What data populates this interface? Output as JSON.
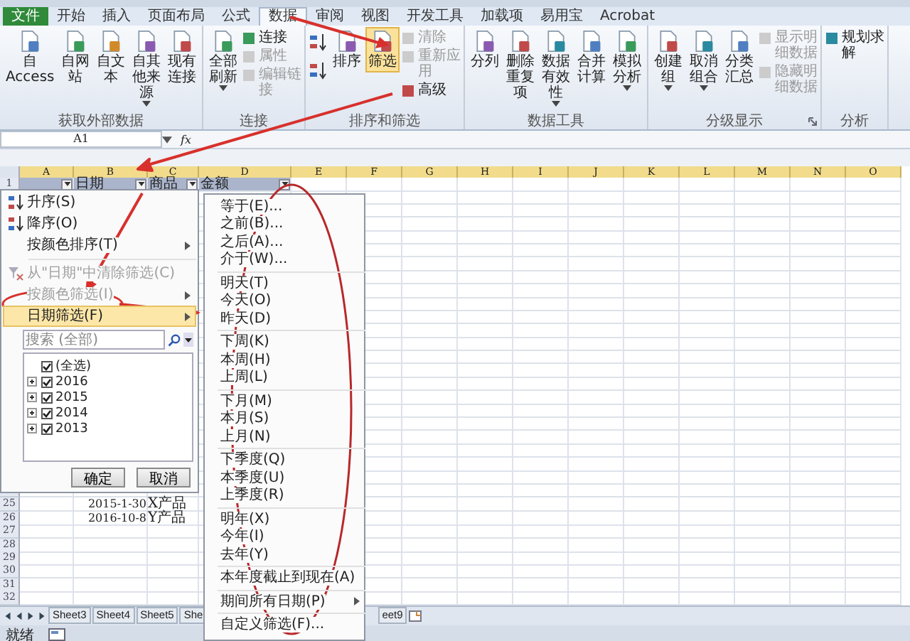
{
  "tabs": [
    {
      "label": "文件",
      "kind": "file",
      "selected": false
    },
    {
      "label": "开始",
      "kind": "tab",
      "selected": false
    },
    {
      "label": "插入",
      "kind": "tab",
      "selected": false
    },
    {
      "label": "页面布局",
      "kind": "tab",
      "selected": false
    },
    {
      "label": "公式",
      "kind": "tab",
      "selected": false
    },
    {
      "label": "数据",
      "kind": "tab",
      "selected": true
    },
    {
      "label": "审阅",
      "kind": "tab",
      "selected": false
    },
    {
      "label": "视图",
      "kind": "tab",
      "selected": false
    },
    {
      "label": "开发工具",
      "kind": "tab",
      "selected": false
    },
    {
      "label": "加载项",
      "kind": "tab",
      "selected": false
    },
    {
      "label": "易用宝",
      "kind": "tab",
      "selected": false
    },
    {
      "label": "Acrobat",
      "kind": "tab",
      "selected": false
    }
  ],
  "ribbon": {
    "groups": [
      {
        "label": "获取外部数据",
        "items": [
          {
            "kind": "large",
            "label": "自Access",
            "on": false,
            "dropdown": false
          },
          {
            "kind": "large",
            "label": "自网站",
            "on": false,
            "dropdown": false
          },
          {
            "kind": "large",
            "label": "自文本",
            "on": false,
            "dropdown": false
          },
          {
            "kind": "large",
            "label": "自其他来源",
            "on": false,
            "dropdown": true
          },
          {
            "kind": "large",
            "label": "现有连接",
            "on": false,
            "dropdown": false
          }
        ]
      },
      {
        "label": "连接",
        "items": [
          {
            "kind": "large",
            "label": "全部刷新",
            "on": false,
            "dropdown": true
          },
          {
            "kind": "stack",
            "items": [
              {
                "label": "连接",
                "disabled": false
              },
              {
                "label": "属性",
                "disabled": true
              },
              {
                "label": "编辑链接",
                "disabled": true
              }
            ]
          }
        ]
      },
      {
        "label": "排序和筛选",
        "items": [
          {
            "kind": "sort"
          },
          {
            "kind": "large",
            "label": "排序",
            "on": false,
            "dropdown": false
          },
          {
            "kind": "large",
            "label": "筛选",
            "on": true,
            "dropdown": false
          },
          {
            "kind": "stack",
            "items": [
              {
                "label": "清除",
                "disabled": true
              },
              {
                "label": "重新应用",
                "disabled": true
              },
              {
                "label": "高级",
                "disabled": false
              }
            ]
          }
        ]
      },
      {
        "label": "数据工具",
        "items": [
          {
            "kind": "large",
            "label": "分列",
            "on": false,
            "dropdown": false
          },
          {
            "kind": "large",
            "label": "删除重复项",
            "on": false,
            "dropdown": false
          },
          {
            "kind": "large",
            "label": "数据有效性",
            "on": false,
            "dropdown": true
          },
          {
            "kind": "large",
            "label": "合并计算",
            "on": false,
            "dropdown": false
          },
          {
            "kind": "large",
            "label": "模拟分析",
            "on": false,
            "dropdown": true
          }
        ]
      },
      {
        "label": "分级显示",
        "launcher": true,
        "items": [
          {
            "kind": "large",
            "label": "创建组",
            "on": false,
            "dropdown": true
          },
          {
            "kind": "large",
            "label": "取消组合",
            "on": false,
            "dropdown": true
          },
          {
            "kind": "large",
            "label": "分类汇总",
            "on": false,
            "dropdown": false
          },
          {
            "kind": "stack",
            "items": [
              {
                "label": "显示明细数据",
                "disabled": true
              },
              {
                "label": "隐藏明细数据",
                "disabled": true
              }
            ]
          }
        ]
      },
      {
        "label": "分析",
        "items": [
          {
            "kind": "stack",
            "items": [
              {
                "label": "规划求解",
                "disabled": false
              }
            ]
          }
        ]
      }
    ]
  },
  "formula_bar": {
    "name_box": "A1",
    "function_label": "fx"
  },
  "grid": {
    "columns": [
      "A",
      "B",
      "C",
      "D",
      "E",
      "F",
      "G",
      "H",
      "I",
      "J",
      "K",
      "L",
      "M",
      "N",
      "O"
    ],
    "rows": [
      {
        "number": "1",
        "cells": [
          {
            "filter": true
          },
          {
            "text": "日期",
            "filter": true
          },
          {
            "text": "商品",
            "filter": true
          },
          {
            "text": "金额",
            "filter": true
          }
        ]
      },
      {
        "number": "25",
        "cells": [
          {
            "filter": false
          },
          {
            "text": "2015-1-30",
            "filter": false
          },
          {
            "text": "X产品",
            "filter": false
          }
        ]
      },
      {
        "number": "26",
        "cells": [
          {
            "filter": false
          },
          {
            "text": "2016-10-8",
            "filter": false
          },
          {
            "text": "Y产品",
            "filter": false
          }
        ]
      },
      {
        "number": "27"
      },
      {
        "number": "28"
      },
      {
        "number": "29"
      },
      {
        "number": "30"
      },
      {
        "number": "31"
      },
      {
        "number": "32"
      }
    ]
  },
  "filter_menu": {
    "items": [
      {
        "kind": "sort_asc",
        "label": "升序(S)",
        "disabled": false,
        "selected": false,
        "submenu": false
      },
      {
        "kind": "sort_desc",
        "label": "降序(O)",
        "disabled": false,
        "selected": false,
        "submenu": false
      },
      {
        "kind": "plain",
        "label": "按颜色排序(T)",
        "disabled": false,
        "selected": false,
        "submenu": true
      },
      {
        "kind": "clear",
        "label": "从\"日期\"中清除筛选(C)",
        "disabled": true,
        "selected": false,
        "submenu": false
      },
      {
        "kind": "plain",
        "label": "按颜色筛选(I)",
        "disabled": true,
        "selected": false,
        "submenu": true
      },
      {
        "kind": "plain",
        "label": "日期筛选(F)",
        "disabled": false,
        "selected": true,
        "submenu": true
      }
    ],
    "search": {
      "placeholder": "搜索 (全部)"
    },
    "tree": [
      {
        "label": "(全选)",
        "checked": true
      },
      {
        "label": "2016",
        "checked": true,
        "expanded": false
      },
      {
        "label": "2015",
        "checked": true,
        "expanded": false
      },
      {
        "label": "2014",
        "checked": true,
        "expanded": false
      },
      {
        "label": "2013",
        "checked": true,
        "expanded": false
      }
    ],
    "buttons": [
      "确定",
      "取消"
    ]
  },
  "date_filter_menu": {
    "groups": [
      [
        {
          "label": "等于(E)..."
        },
        {
          "label": "之前(B)..."
        },
        {
          "label": "之后(A)..."
        },
        {
          "label": "介于(W)..."
        }
      ],
      [
        {
          "label": "明天(T)"
        },
        {
          "label": "今天(O)"
        },
        {
          "label": "昨天(D)"
        }
      ],
      [
        {
          "label": "下周(K)"
        },
        {
          "label": "本周(H)"
        },
        {
          "label": "上周(L)"
        }
      ],
      [
        {
          "label": "下月(M)"
        },
        {
          "label": "本月(S)"
        },
        {
          "label": "上月(N)"
        }
      ],
      [
        {
          "label": "下季度(Q)"
        },
        {
          "label": "本季度(U)"
        },
        {
          "label": "上季度(R)"
        }
      ],
      [
        {
          "label": "明年(X)"
        },
        {
          "label": "今年(I)"
        },
        {
          "label": "去年(Y)"
        }
      ],
      [
        {
          "label": "本年度截止到现在(A)"
        }
      ],
      [
        {
          "label": "期间所有日期(P)",
          "submenu": true
        }
      ],
      [
        {
          "label": "自定义筛选(F)..."
        }
      ]
    ]
  },
  "sheet_tabs": [
    {
      "label": "Sheet3",
      "selected": false
    },
    {
      "label": "Sheet4",
      "selected": false
    },
    {
      "label": "Sheet5",
      "selected": false
    },
    {
      "label": "She",
      "selected": false
    },
    {
      "label": "eet9",
      "selected": false
    }
  ],
  "status_bar": {
    "text": "就绪"
  }
}
